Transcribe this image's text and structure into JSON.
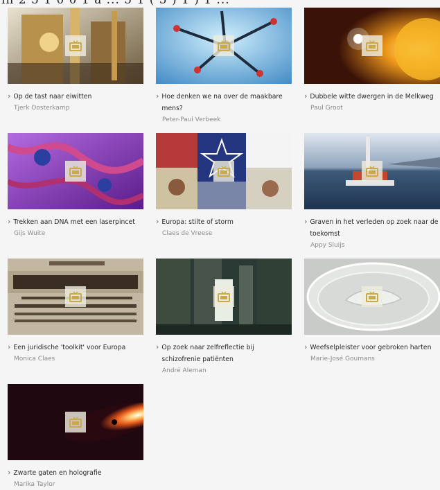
{
  "header": {
    "cut_text": "in 2 5 1 0 0 1 a ... 5 1 ( 5 ) 1 ) 1 ..."
  },
  "icons": {
    "play": "tv-play-icon",
    "chevron": "chevron-right-icon"
  },
  "colors": {
    "play_overlay": "#eeecde",
    "tv_icon": "#c9a94a"
  },
  "items": [
    {
      "title": "Op de tast naar eiwitten",
      "author": "Tjerk Oosterkamp"
    },
    {
      "title": "Hoe denken we na over de maakbare mens?",
      "author": "Peter-Paul Verbeek"
    },
    {
      "title": "Dubbele witte dwergen in de Melkweg",
      "author": "Paul Groot"
    },
    {
      "title": "Trekken aan DNA met een laserpincet",
      "author": "Gijs Wuite"
    },
    {
      "title": "Europa: stilte of storm",
      "author": "Claes de Vreese"
    },
    {
      "title": "Graven in het verleden op zoek naar de toekomst",
      "author": "Appy Sluijs"
    },
    {
      "title": "Een juridische 'toolkit' voor Europa",
      "author": "Monica Claes"
    },
    {
      "title": "Op zoek naar zelfreflectie bij schizofrenie patiënten",
      "author": "André Aleman"
    },
    {
      "title": "Weefselpleister voor gebroken harten",
      "author": "Marie-José Goumans"
    },
    {
      "title": "Zwarte gaten en holografie",
      "author": "Marika Taylor"
    }
  ]
}
